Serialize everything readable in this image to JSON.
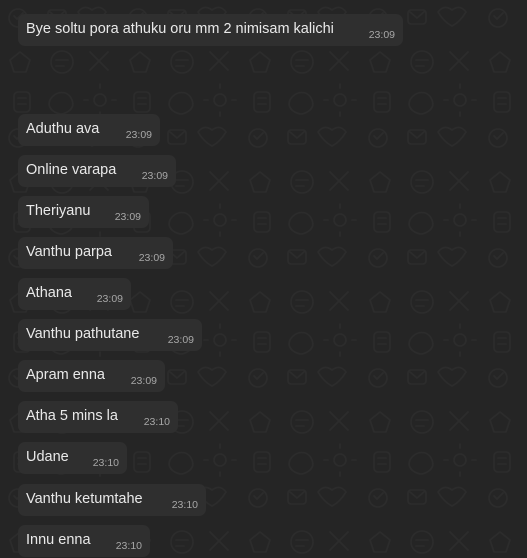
{
  "messages": [
    {
      "text": "Bye soltu pora athuku oru mm 2 nimisam kalichi",
      "time": "23:09"
    },
    {
      "text": "Aduthu ava",
      "time": "23:09"
    },
    {
      "text": "Online varapa",
      "time": "23:09"
    },
    {
      "text": "Theriyanu",
      "time": "23:09"
    },
    {
      "text": "Vanthu parpa",
      "time": "23:09"
    },
    {
      "text": "Athana",
      "time": "23:09"
    },
    {
      "text": "Vanthu pathutane",
      "time": "23:09"
    },
    {
      "text": "Apram enna",
      "time": "23:09"
    },
    {
      "text": "Atha 5 mins la",
      "time": "23:10"
    },
    {
      "text": "Udane",
      "time": "23:10"
    },
    {
      "text": "Vanthu ketumtahe",
      "time": "23:10"
    },
    {
      "text": "Innu enna",
      "time": "23:10"
    }
  ],
  "colors": {
    "background": "#252525",
    "bubble": "#2f2f2f",
    "text": "#e9e9e9",
    "timestamp": "#a7a7a7"
  }
}
